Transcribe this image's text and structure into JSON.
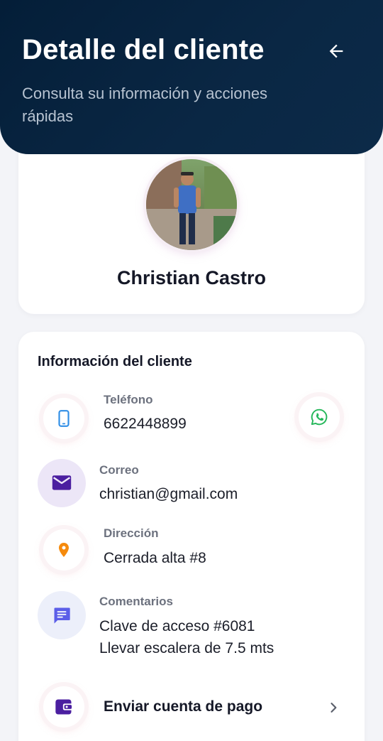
{
  "header": {
    "title": "Detalle del cliente",
    "subtitle": "Consulta su información y acciones rápidas",
    "back_icon": "arrow-left-icon"
  },
  "profile": {
    "name": "Christian Castro"
  },
  "info": {
    "section_title": "Información del cliente",
    "phone": {
      "label": "Teléfono",
      "value": "6622448899",
      "icon": "phone-icon",
      "action_icon": "whatsapp-icon"
    },
    "email": {
      "label": "Correo",
      "value": "christian@gmail.com",
      "icon": "mail-icon"
    },
    "address": {
      "label": "Dirección",
      "value": "Cerrada alta #8",
      "icon": "location-pin-icon"
    },
    "comments": {
      "label": "Comentarios",
      "line1": "Clave de acceso #6081",
      "line2": "Llevar escalera de 7.5 mts",
      "icon": "chat-icon"
    }
  },
  "actions": {
    "send_payment": {
      "label": "Enviar cuenta de pago",
      "icon": "wallet-icon"
    }
  },
  "colors": {
    "header_bg": "#041e38",
    "phone_icon": "#2f8ee6",
    "whatsapp": "#25b75a",
    "mail_icon": "#4b1fa0",
    "mail_bg": "#ece6f7",
    "pin_icon": "#f58a0c",
    "chat_icon": "#5b5ee8",
    "chat_bg": "#eceffa",
    "wallet_icon": "#4b1fa0"
  }
}
